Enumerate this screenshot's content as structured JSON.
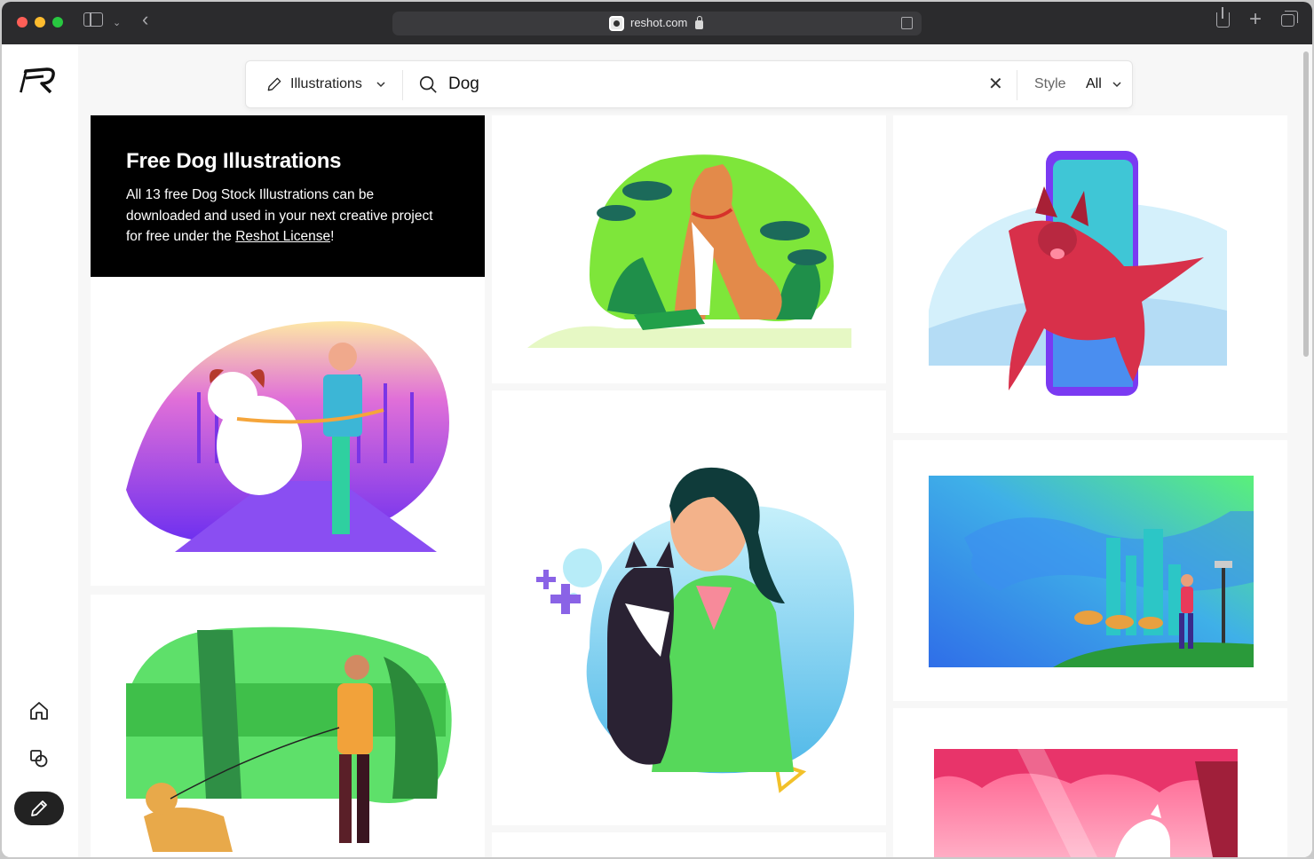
{
  "browser": {
    "url": "reshot.com"
  },
  "search": {
    "type_label": "Illustrations",
    "query": "Dog",
    "style_label": "Style",
    "style_value": "All"
  },
  "intro": {
    "title": "Free Dog Illustrations",
    "text_before": "All 13 free Dog Stock Illustrations can be downloaded and used in your next creative project for free under the ",
    "link_text": "Reshot License",
    "text_after": "!"
  },
  "nav": {
    "items": [
      "home-icon",
      "shapes-icon",
      "pencil-icon"
    ]
  },
  "colors": {
    "toolbar": "#2b2b2d",
    "intro_bg": "#000000",
    "active_nav": "#222222"
  }
}
